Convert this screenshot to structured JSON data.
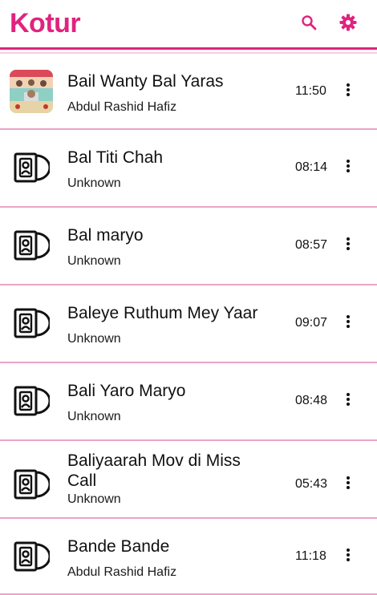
{
  "app": {
    "title": "Kotur",
    "accent": "#e0237f",
    "divider": "#f2a6c9",
    "row_divider": "#eba3c6"
  },
  "icons": {
    "search": "search-icon",
    "settings": "gear-icon",
    "more": "more-vert-icon",
    "song": "music-disc-icon"
  },
  "songs": [
    {
      "title": "Bail Wanty Bal Yaras",
      "artist": "Abdul Rashid Hafiz",
      "duration": "11:50",
      "art": "album-art"
    },
    {
      "title": "Bal Titi Chah",
      "artist": "Unknown",
      "duration": "08:14",
      "art": "music-disc-icon"
    },
    {
      "title": "Bal maryo",
      "artist": "Unknown",
      "duration": "08:57",
      "art": "music-disc-icon"
    },
    {
      "title": "Baleye Ruthum Mey Yaar",
      "artist": "Unknown",
      "duration": "09:07",
      "art": "music-disc-icon"
    },
    {
      "title": "Bali Yaro Maryo",
      "artist": "Unknown",
      "duration": "08:48",
      "art": "music-disc-icon"
    },
    {
      "title": "Baliyaarah Mov di Miss Call",
      "artist": "Unknown",
      "duration": "05:43",
      "art": "music-disc-icon"
    },
    {
      "title": "Bande Bande",
      "artist": "Abdul Rashid Hafiz",
      "duration": "11:18",
      "art": "music-disc-icon"
    }
  ]
}
